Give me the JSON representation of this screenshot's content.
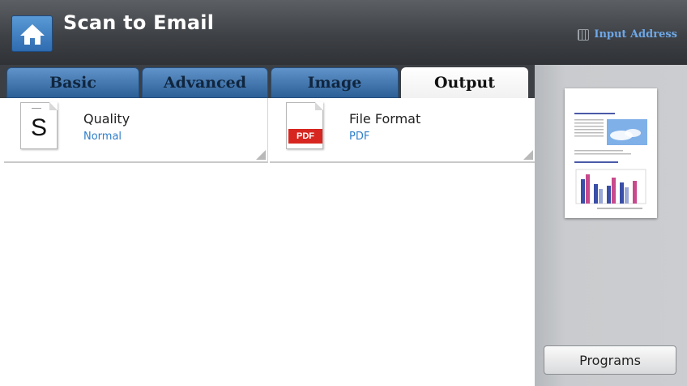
{
  "header": {
    "title": "Scan to Email",
    "home_icon": "home-icon",
    "input_address": {
      "label": "Input Address",
      "icon": "keyboard-icon",
      "color": "#6ea8e8"
    }
  },
  "tabs": [
    {
      "label": "Basic",
      "active": false
    },
    {
      "label": "Advanced",
      "active": false
    },
    {
      "label": "Image",
      "active": false
    },
    {
      "label": "Output",
      "active": true
    }
  ],
  "options": [
    {
      "label": "Quality",
      "value": "Normal",
      "icon": "quality-doc-icon",
      "icon_letter": "S"
    },
    {
      "label": "File Format",
      "value": "PDF",
      "icon": "pdf-file-icon",
      "icon_badge": "PDF"
    }
  ],
  "side_panel": {
    "preview_icon": "document-preview-thumbnail",
    "programs_label": "Programs"
  },
  "colors": {
    "accent_blue": "#2f7fc9",
    "tab_blue": "#3d74ae",
    "header_dark": "#3e4145",
    "pdf_red": "#d7261f"
  }
}
